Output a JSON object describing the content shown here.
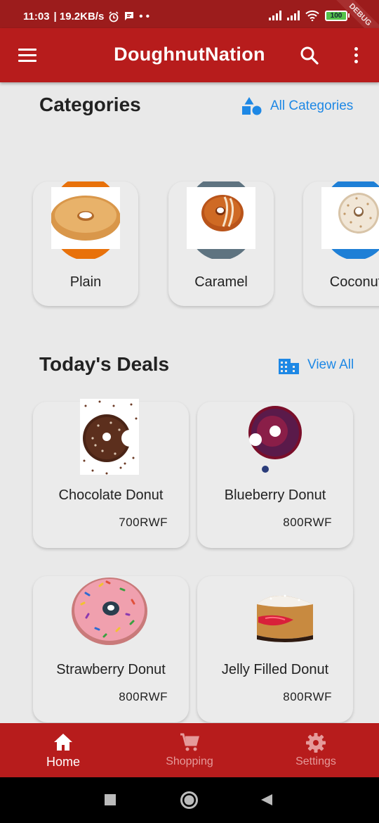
{
  "status_bar": {
    "time": "11:03",
    "speed": "| 19.2KB/s",
    "extra": "• •",
    "battery": "100",
    "debug_label": "DEBUG"
  },
  "app_bar": {
    "title": "DoughnutNation"
  },
  "categories_section": {
    "title": "Categories",
    "link_label": "All Categories",
    "items": [
      {
        "label": "Plain",
        "color": "#e8710a"
      },
      {
        "label": "Caramel",
        "color": "#5e7380"
      },
      {
        "label": "Coconut",
        "color": "#1e7fd6"
      }
    ]
  },
  "deals_section": {
    "title": "Today's Deals",
    "link_label": "View All",
    "items": [
      {
        "name": "Chocolate Donut",
        "price": "700RWF"
      },
      {
        "name": "Blueberry Donut",
        "price": "800RWF"
      },
      {
        "name": "Strawberry Donut",
        "price": "800RWF"
      },
      {
        "name": "Jelly Filled Donut",
        "price": "800RWF"
      }
    ]
  },
  "bottom_nav": {
    "items": [
      {
        "label": "Home",
        "active": true
      },
      {
        "label": "Shopping",
        "active": false
      },
      {
        "label": "Settings",
        "active": false
      }
    ]
  },
  "colors": {
    "primary": "#b71c1c",
    "status_bar": "#9c1c1c",
    "link": "#1e88e5",
    "background": "#e9e9e9"
  }
}
